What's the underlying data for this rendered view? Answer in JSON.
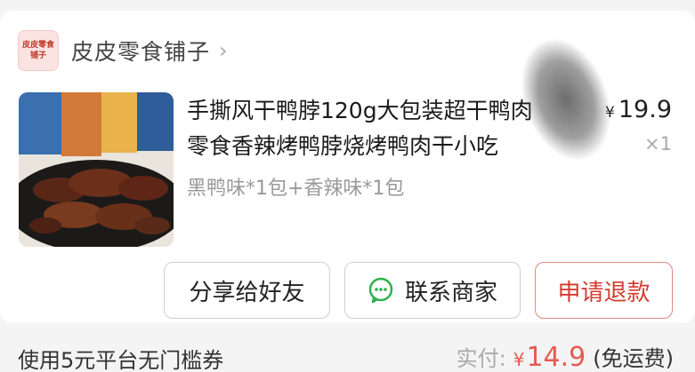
{
  "shop": {
    "logo_line1": "皮皮零食",
    "logo_line2": "铺子",
    "name": "皮皮零食铺子",
    "chevron": "›"
  },
  "product": {
    "title_line1": "手撕风干鸭脖120g大包装超干鸭肉",
    "title_line2": "零食香辣烤鸭脖烧烤鸭肉干小吃",
    "variant": "黑鸭味*1包+香辣味*1包",
    "price_symbol": "¥",
    "price": "19.9",
    "quantity": "×1"
  },
  "actions": {
    "share_label": "分享给好友",
    "contact_label": "联系商家",
    "refund_label": "申请退款"
  },
  "footer": {
    "coupon_text": "使用5元平台无门槛券",
    "paid_label": "实付:",
    "paid_symbol": "¥",
    "paid_amount": "14.9",
    "paid_note": "(免运费)"
  },
  "colors": {
    "accent_red": "#d43a2f",
    "price_red": "#e65a50",
    "wechat_green": "#2bb24c"
  },
  "icons": {
    "chevron": "chevron-right-icon",
    "contact": "wechat-icon"
  }
}
